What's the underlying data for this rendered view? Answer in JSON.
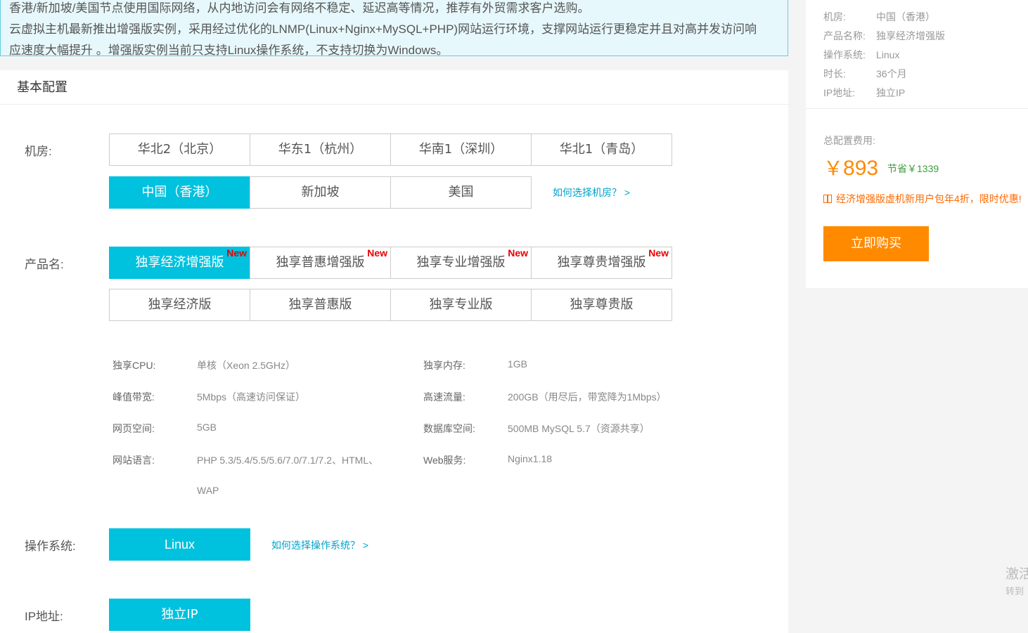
{
  "notice": {
    "line1": "香港/新加坡/美国节点使用国际网络，从内地访问会有网络不稳定、延迟高等情况，推荐有外贸需求客户选购。",
    "line2": "云虚拟主机最新推出增强版实例，采用经过优化的LNMP(Linux+Nginx+MySQL+PHP)网站运行环境，支撑网站运行更稳定并且对高并发访问响",
    "line3": "应速度大幅提升 。增强版实例当前只支持Linux操作系统，不支持切换为Windows。"
  },
  "section_title": "基本配置",
  "region": {
    "label": "机房:",
    "options": [
      "华北2（北京）",
      "华东1（杭州）",
      "华南1（深圳）",
      "华北1（青岛）",
      "中国（香港）",
      "新加坡",
      "美国"
    ],
    "selected": "中国（香港）",
    "help": "如何选择机房？ >"
  },
  "product": {
    "label": "产品名:",
    "options": [
      "独享经济增强版",
      "独享普惠增强版",
      "独享专业增强版",
      "独享尊贵增强版",
      "独享经济版",
      "独享普惠版",
      "独享专业版",
      "独享尊贵版"
    ],
    "new_tag": "New",
    "selected": "独享经济增强版"
  },
  "specs": {
    "cpu_label": "独享CPU:",
    "cpu_value": "单核（Xeon 2.5GHz）",
    "mem_label": "独享内存:",
    "mem_value": "1GB",
    "bw_label": "峰值带宽:",
    "bw_value": "5Mbps（高速访问保证）",
    "traffic_label": "高速流量:",
    "traffic_value": "200GB（用尽后，带宽降为1Mbps）",
    "web_label": "网页空间:",
    "web_value": "5GB",
    "db_label": "数据库空间:",
    "db_value": "500MB MySQL 5.7（资源共享）",
    "lang_label": "网站语言:",
    "lang_value": "PHP 5.3/5.4/5.5/5.6/7.0/7.1/7.2、HTML、",
    "lang_value2": "WAP",
    "server_label": "Web服务:",
    "server_value": "Nginx1.18"
  },
  "os": {
    "label": "操作系统:",
    "option": "Linux",
    "help": "如何选择操作系统？ >"
  },
  "ip": {
    "label": "IP地址:",
    "option": "独立IP"
  },
  "summary": {
    "region_k": "机房:",
    "region_v": "中国（香港）",
    "product_k": "产品名称:",
    "product_v": "独享经济增强版",
    "os_k": "操作系统:",
    "os_v": "Linux",
    "duration_k": "时长:",
    "duration_v": "36个月",
    "ip_k": "IP地址:",
    "ip_v": "独立IP",
    "total_label": "总配置费用:",
    "currency": "￥",
    "price": "893",
    "saving": "节省￥1339",
    "promo": "经济增强版虚机新用户包年4折，限时优惠!",
    "buy": "立即购买"
  },
  "watermark": {
    "line1": "激活",
    "line2": "转到"
  },
  "colors": {
    "accent": "#00c1de",
    "orange": "#ff8a00",
    "link": "#00a2ca",
    "new": "#e80000"
  }
}
